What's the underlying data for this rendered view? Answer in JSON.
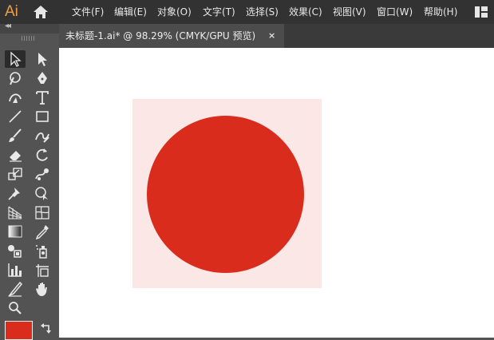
{
  "app": {
    "logo": "Ai",
    "accent_color": "#f19e4a"
  },
  "menu": [
    "文件(F)",
    "编辑(E)",
    "对象(O)",
    "文字(T)",
    "选择(S)",
    "效果(C)",
    "视图(V)",
    "窗口(W)",
    "帮助(H)"
  ],
  "document_tab": {
    "title": "未标题-1.ai* @ 98.29% (CMYK/GPU 预览)",
    "close": "×"
  },
  "toolbar": {
    "collapse": "◂◂",
    "tools": [
      "selection-tool",
      "direct-selection-tool",
      "magic-wand-tool",
      "pen-tool",
      "curvature-tool",
      "type-tool",
      "line-segment-tool",
      "rectangle-tool",
      "paintbrush-tool",
      "shaper-tool",
      "eraser-tool",
      "rotate-tool",
      "scale-tool",
      "puppet-warp-tool",
      "pin-tool",
      "shape-builder-tool",
      "perspective-grid-tool",
      "mesh-tool",
      "gradient-tool",
      "eyedropper-tool",
      "blend-tool",
      "symbol-sprayer-tool",
      "column-graph-tool",
      "artboard-tool",
      "slice-tool",
      "hand-tool",
      "zoom-tool"
    ],
    "active_tool": "selection-tool",
    "fill_color": "#d92c1d"
  },
  "canvas": {
    "artboard_color": "#fbe7e6",
    "shape": "circle",
    "shape_color": "#d92c1d"
  }
}
